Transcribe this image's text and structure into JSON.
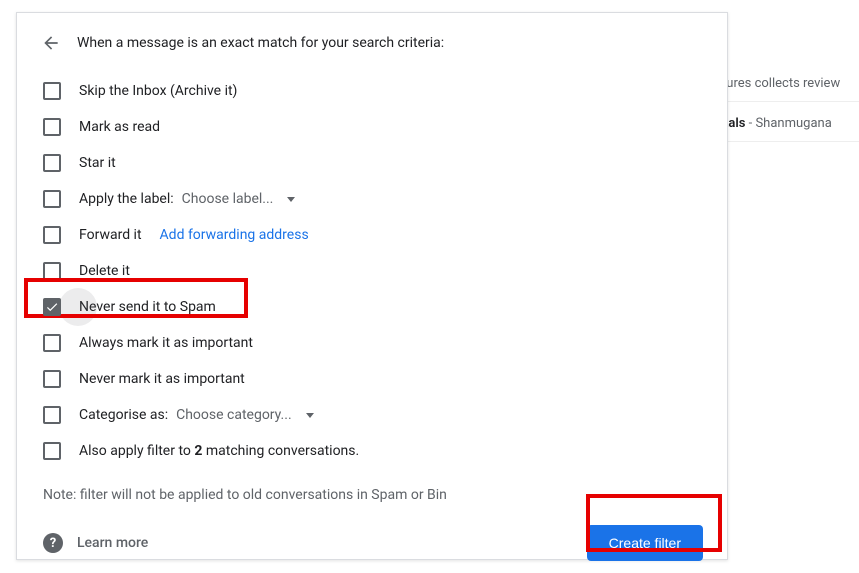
{
  "header": "When a message is an exact match for your search criteria:",
  "options": {
    "skip_inbox": "Skip the Inbox (Archive it)",
    "mark_read": "Mark as read",
    "star_it": "Star it",
    "apply_label_prefix": "Apply the label:",
    "apply_label_dropdown": "Choose label...",
    "forward_it": "Forward it",
    "forward_link": "Add forwarding address",
    "delete_it": "Delete it",
    "never_spam": "Never send it to Spam",
    "always_important": "Always mark it as important",
    "never_important": "Never mark it as important",
    "categorise_prefix": "Categorise as:",
    "categorise_dropdown": "Choose category...",
    "also_apply_pre": "Also apply filter to ",
    "also_apply_count": "2",
    "also_apply_post": " matching conversations."
  },
  "note": "Note: filter will not be applied to old conversations in Spam or Bin",
  "learn_more": "Learn more",
  "create_button": "Create filter",
  "bg": {
    "row1_pre": "gures collects review",
    "row2_bold": "rtals",
    "row2_rest": " - Shanmugana"
  }
}
